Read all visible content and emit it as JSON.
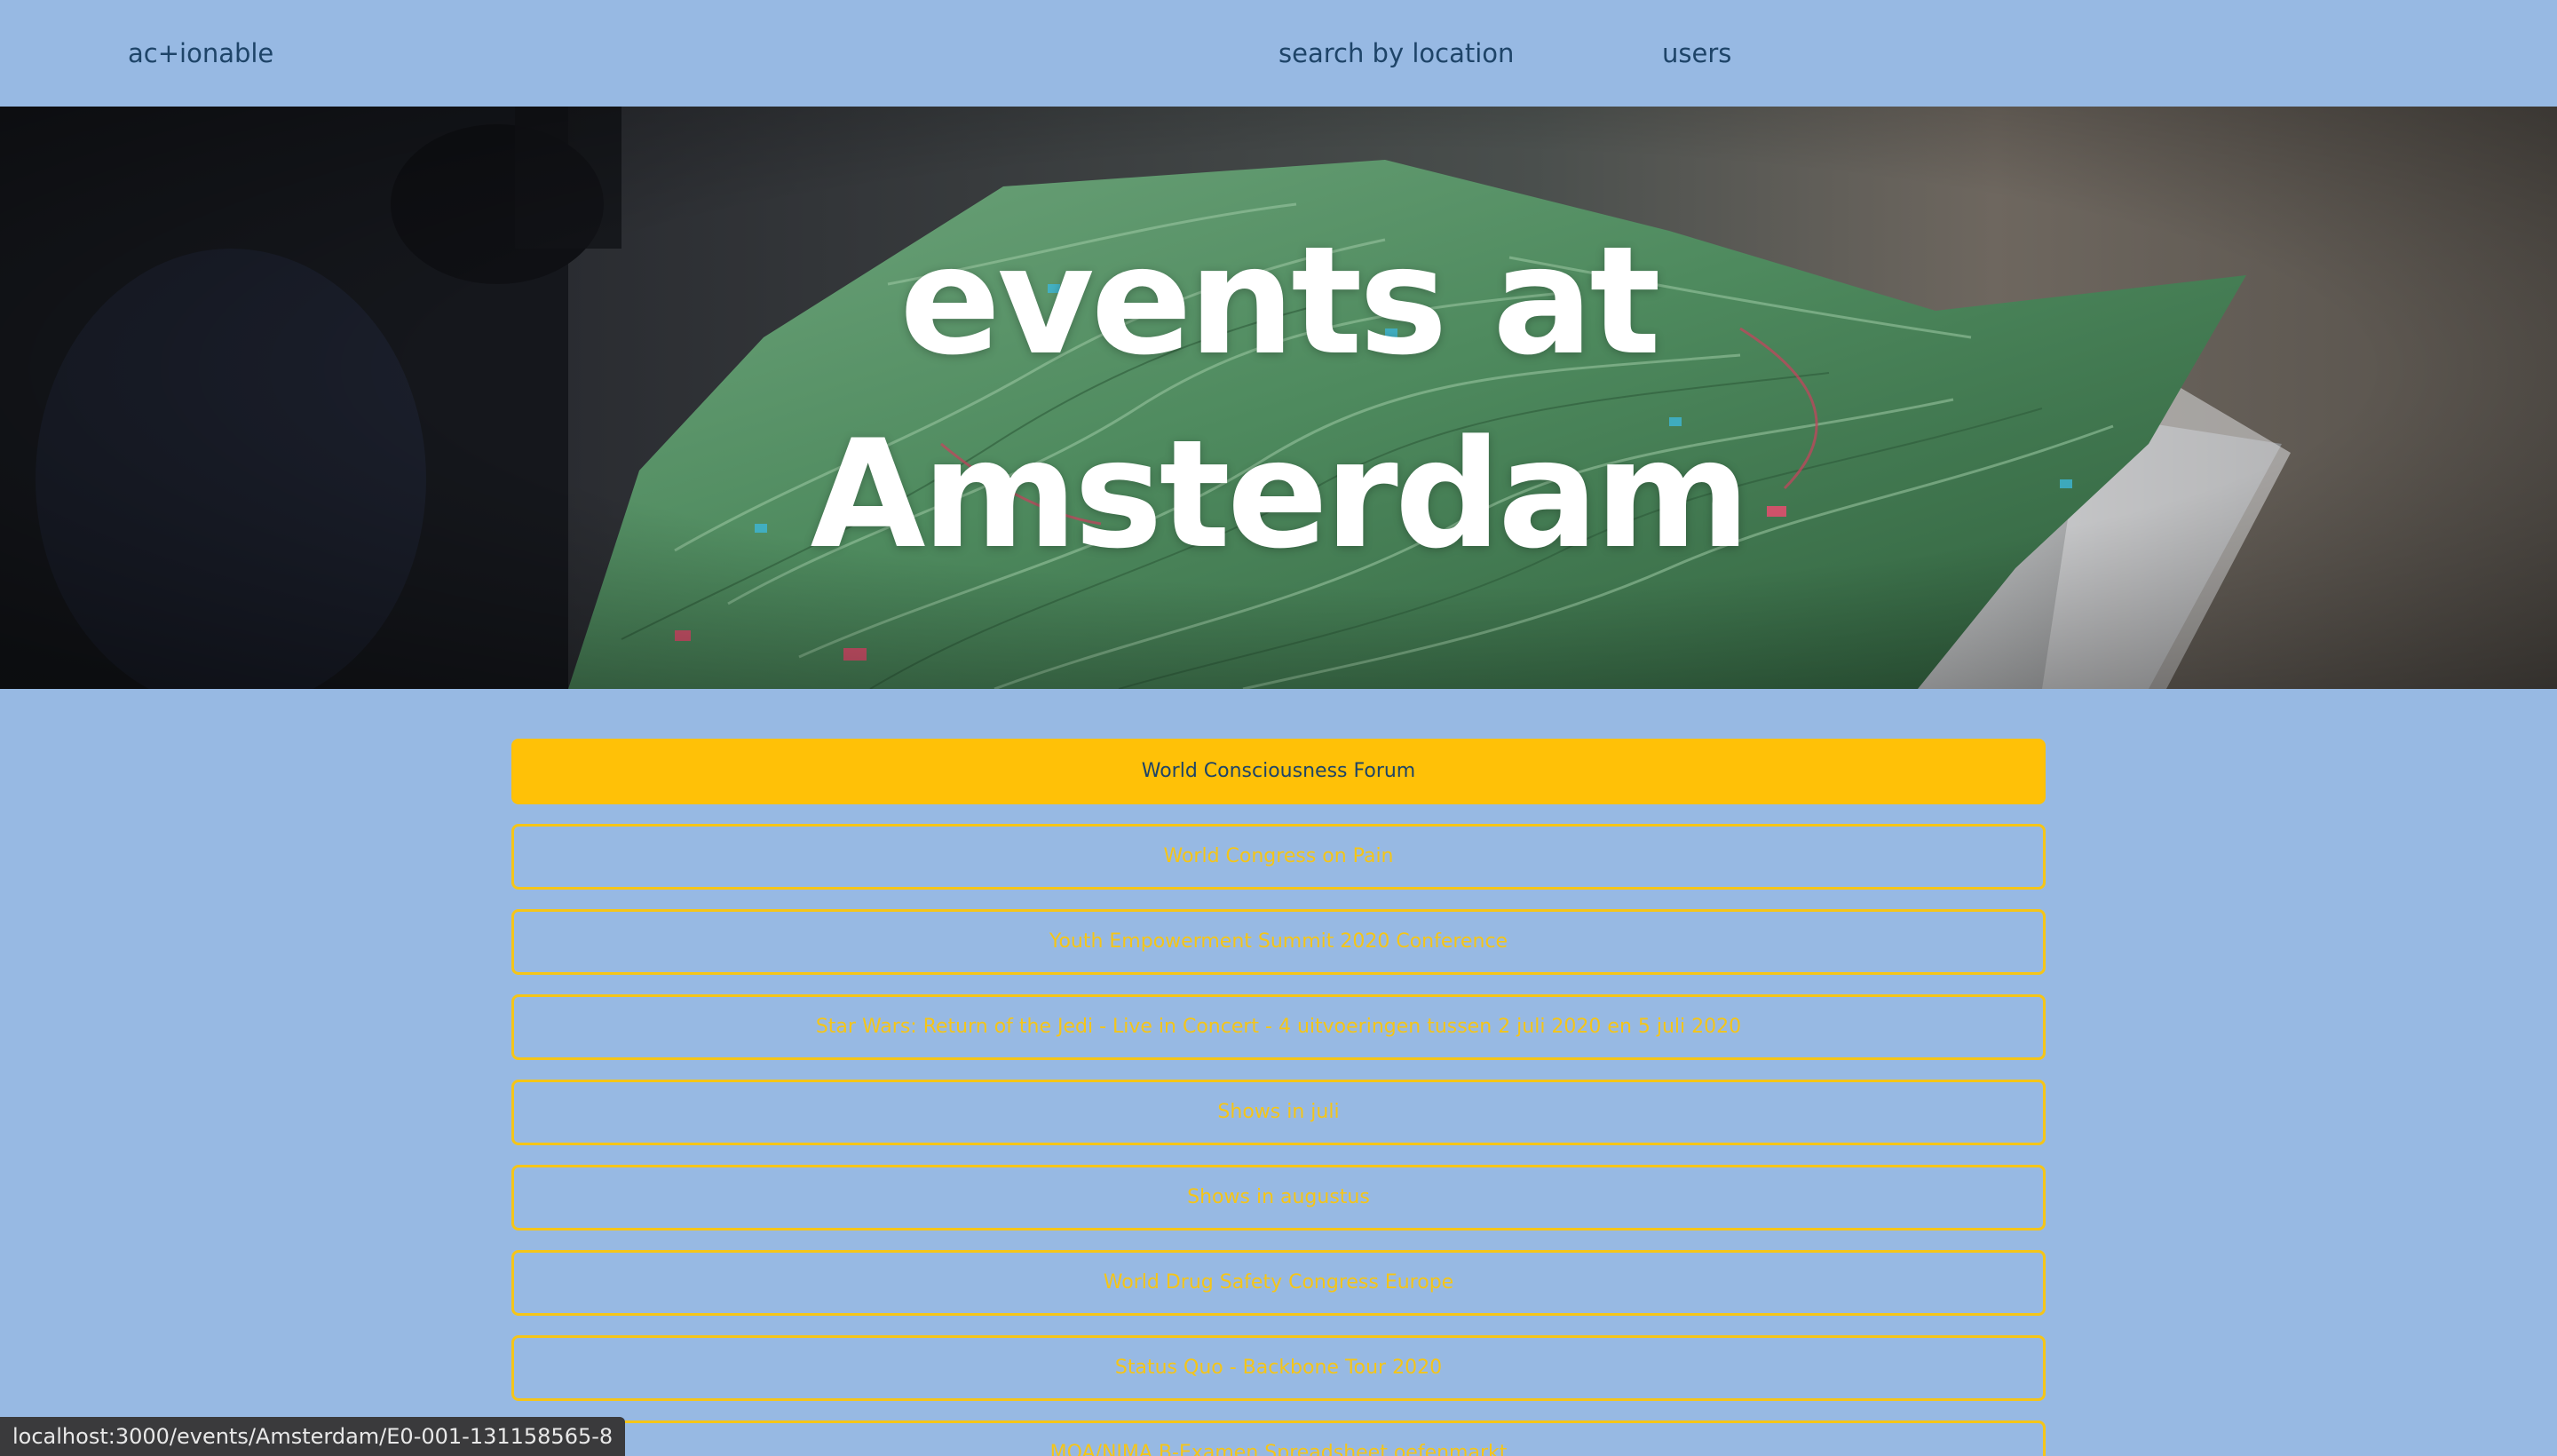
{
  "nav": {
    "brand": "ac+ionable",
    "links": [
      "search by location",
      "users"
    ]
  },
  "hero": {
    "title_line1": "events at",
    "title_line2": "Amsterdam",
    "background": "map-photo"
  },
  "events": [
    {
      "title": "World Consciousness Forum",
      "active": true
    },
    {
      "title": "World Congress on Pain",
      "active": false
    },
    {
      "title": "Youth Empowerment Summit 2020 Conference",
      "active": false
    },
    {
      "title": "Star Wars: Return of the Jedi - Live in Concert - 4 uitvoeringen tussen 2 juli 2020 en 5 juli 2020",
      "active": false
    },
    {
      "title": "Shows in juli",
      "active": false
    },
    {
      "title": "Shows in augustus",
      "active": false
    },
    {
      "title": "World Drug Safety Congress Europe",
      "active": false
    },
    {
      "title": "Status Quo - Backbone Tour 2020",
      "active": false
    },
    {
      "title": "MOA/NIMA B-Examen Spreadsheet oefenmarkt",
      "active": false
    }
  ],
  "status_bar": {
    "url": "localhost:3000/events/Amsterdam/E0-001-131158565-8"
  },
  "colors": {
    "page_bg": "#97B9E3",
    "accent": "#FFC107",
    "outline": "#F5C518",
    "nav_text": "#1E4468"
  }
}
